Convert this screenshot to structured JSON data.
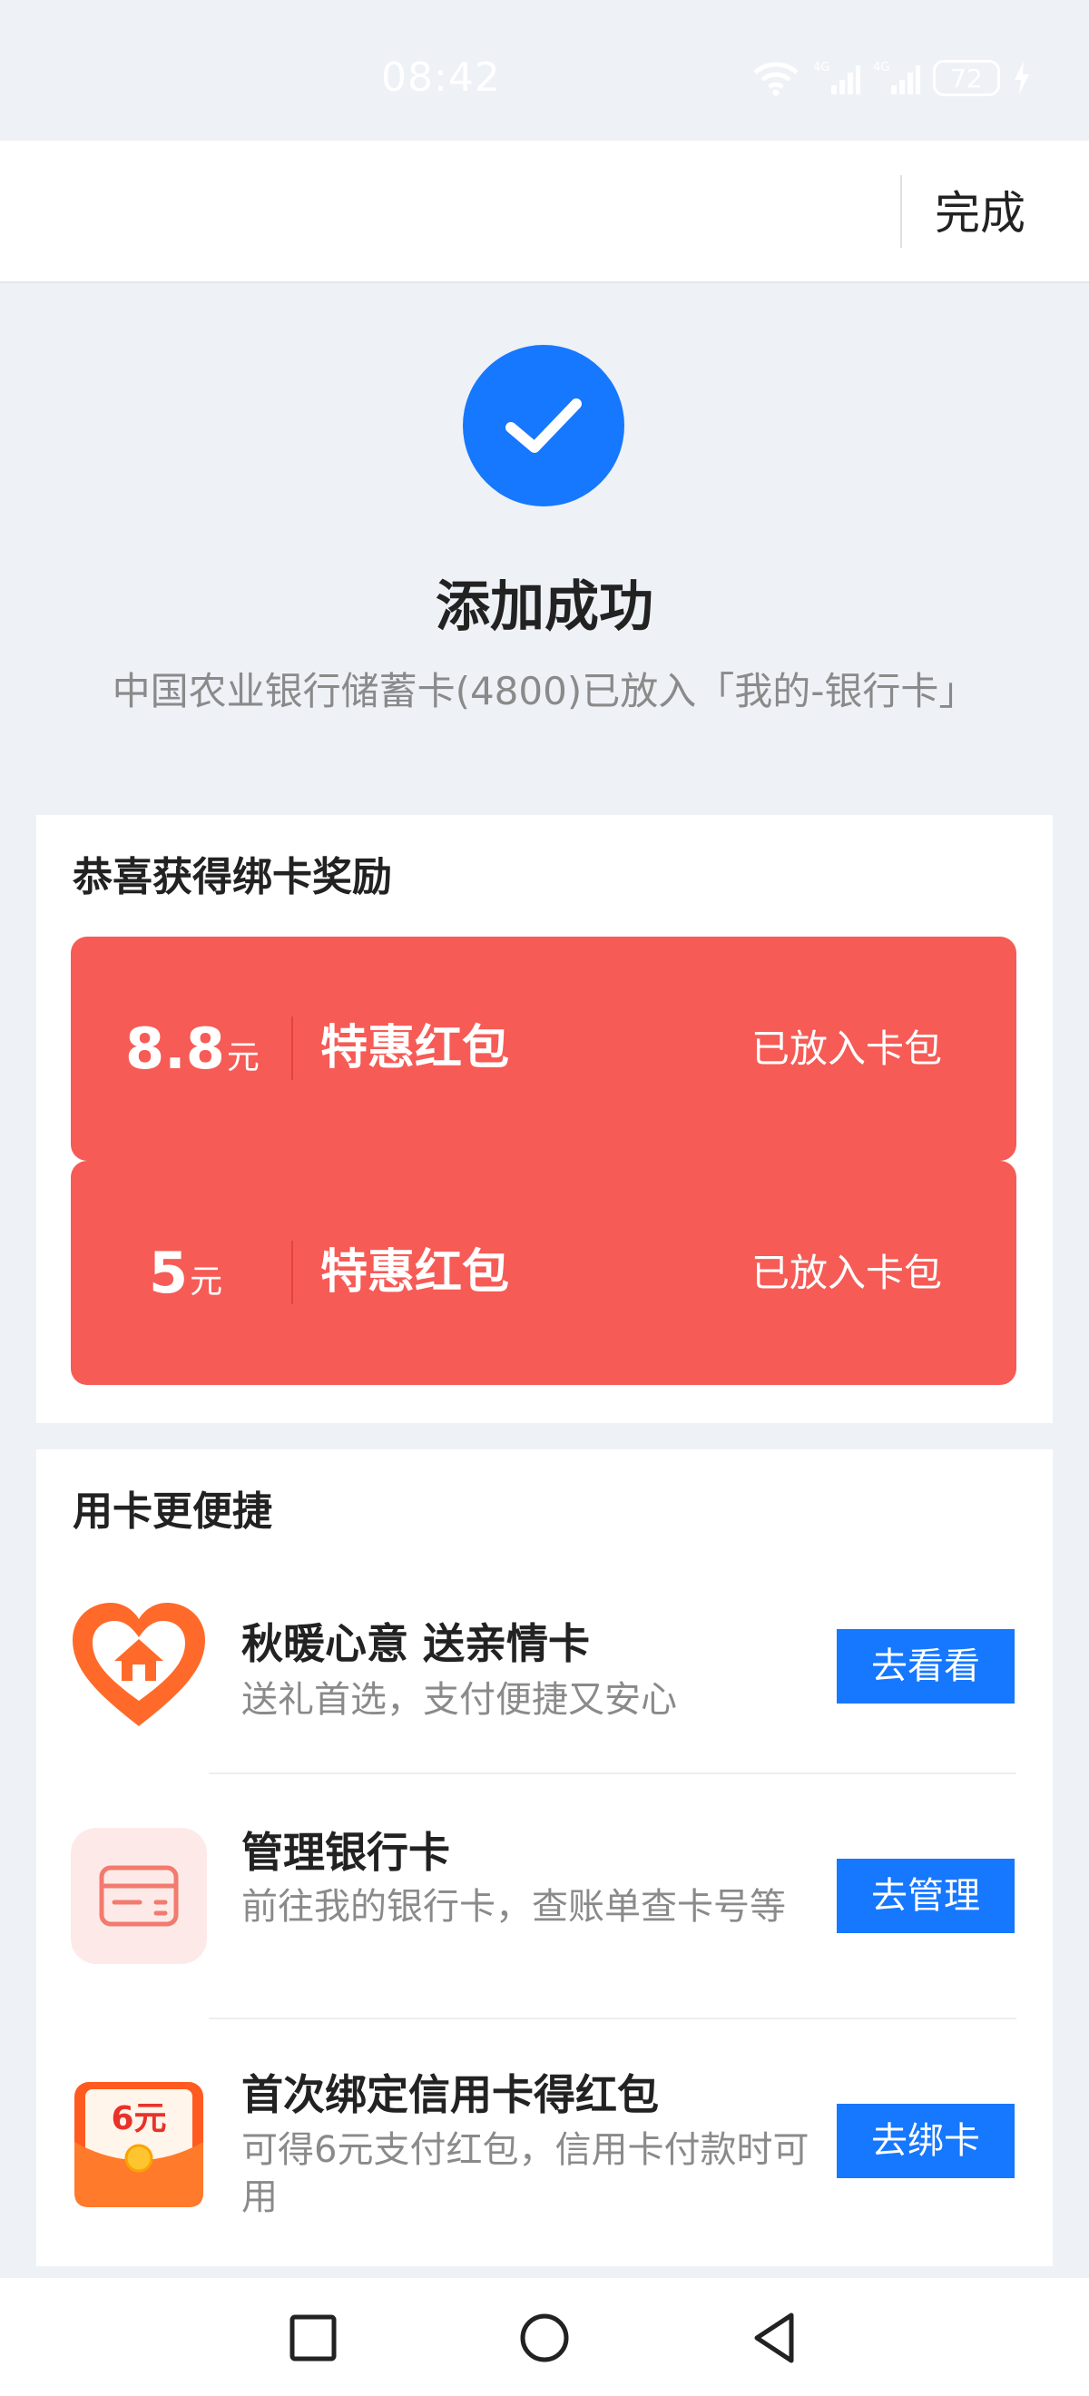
{
  "status_bar": {
    "time": "08:42",
    "battery": "72",
    "network_1": "4G",
    "network_2": "4G",
    "colors": {
      "text": "#ffffff"
    },
    "icons": [
      "wifi-icon",
      "signal-4g-icon",
      "signal-4g-icon",
      "battery-icon",
      "charging-icon"
    ]
  },
  "header": {
    "done_label": "完成"
  },
  "success": {
    "title": "添加成功",
    "subtitle": "中国农业银行储蓄卡(4800)已放入「我的-银行卡」",
    "icon": "check-circle-icon",
    "color": "#1677ff"
  },
  "rewards": {
    "title": "恭喜获得绑卡奖励",
    "coupons": [
      {
        "amount": "8.8",
        "unit": "元",
        "name": "特惠红包",
        "status": "已放入卡包"
      },
      {
        "amount": "5",
        "unit": "元",
        "name": "特惠红包",
        "status": "已放入卡包"
      }
    ],
    "color": "#f65b56"
  },
  "quick": {
    "title": "用卡更便捷",
    "items": [
      {
        "icon": "heart-home-icon",
        "title": "秋暖心意 送亲情卡",
        "desc": "送礼首选，支付便捷又安心",
        "button": "去看看"
      },
      {
        "icon": "bank-card-icon",
        "title": "管理银行卡",
        "desc": "前往我的银行卡，查账单查卡号等",
        "button": "去管理"
      },
      {
        "icon": "red-envelope-icon",
        "badge": "6元",
        "title": "首次绑定信用卡得红包",
        "desc": "可得6元支付红包，信用卡付款时可用",
        "button": "去绑卡"
      }
    ],
    "button_color": "#1677ff"
  },
  "nav": {
    "icons": [
      "recent-apps-icon",
      "home-icon",
      "back-icon"
    ]
  }
}
